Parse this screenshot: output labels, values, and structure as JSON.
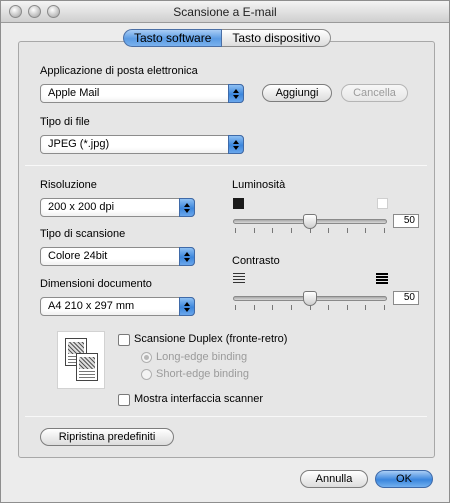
{
  "window": {
    "title": "Scansione a E-mail"
  },
  "tabs": [
    {
      "label": "Tasto software",
      "active": true
    },
    {
      "label": "Tasto dispositivo",
      "active": false
    }
  ],
  "email_app": {
    "label": "Applicazione di posta elettronica",
    "value": "Apple Mail",
    "add_label": "Aggiungi",
    "remove_label": "Cancella"
  },
  "file_type": {
    "label": "Tipo di file",
    "value": "JPEG (*.jpg)"
  },
  "resolution": {
    "label": "Risoluzione",
    "value": "200 x 200 dpi"
  },
  "scan_type": {
    "label": "Tipo di scansione",
    "value": "Colore 24bit"
  },
  "doc_size": {
    "label": "Dimensioni documento",
    "value": "A4  210 x 297 mm"
  },
  "brightness": {
    "label": "Luminosità",
    "value": "50",
    "level": 50
  },
  "contrast": {
    "label": "Contrasto",
    "value": "50",
    "level": 50
  },
  "duplex": {
    "label": "Scansione Duplex (fronte-retro)",
    "checked": false,
    "long_edge": "Long-edge binding",
    "short_edge": "Short-edge binding"
  },
  "show_scanner": {
    "label": "Mostra interfaccia scanner",
    "checked": false
  },
  "restore_label": "Ripristina predefiniti",
  "cancel_label": "Annulla",
  "ok_label": "OK",
  "colors": {
    "accent": "#3c86dc",
    "window_bg": "#ececec"
  }
}
